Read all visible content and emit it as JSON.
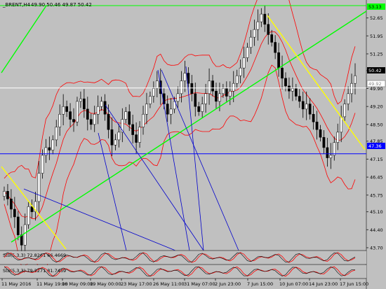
{
  "chart_data": {
    "type": "candlestick",
    "symbol_line": "_BRENT,H4",
    "ohlc_text": "49.90 50.46 49.87 50.42",
    "price_levels": {
      "top_line": 53.13,
      "current": 50.42,
      "ask_line": 49.92,
      "support_line": 47.36
    },
    "y_ticks": [
      "52.65",
      "51.95",
      "51.25",
      "50.60",
      "49.90",
      "49.20",
      "48.50",
      "47.85",
      "47.15",
      "46.45",
      "45.75",
      "45.10",
      "44.40",
      "43.70"
    ],
    "x_ticks": [
      "11 May 2016",
      "11 May 19:00",
      "16 May 09:00",
      "19 May 00:00",
      "23 May 17:00",
      "26 May 11:00",
      "31 May 07:00",
      "2 Jun 23:00",
      "7 Jun 15:00",
      "10 Jun 07:00",
      "14 Jun 23:00",
      "17 Jun 15:00"
    ],
    "price_close_series": [
      45.9,
      45.6,
      45.2,
      44.9,
      44.2,
      43.8,
      44.6,
      45.3,
      45.1,
      45.5,
      46.6,
      47.3,
      47.6,
      47.5,
      47.9,
      48.4,
      48.9,
      49.2,
      49.0,
      48.7,
      48.6,
      49.4,
      49.5,
      49.1,
      48.7,
      48.5,
      48.9,
      49.2,
      49.4,
      48.9,
      48.3,
      47.7,
      47.9,
      48.2,
      48.7,
      49.0,
      48.5,
      48.1,
      47.8,
      48.4,
      48.9,
      49.3,
      49.6,
      49.9,
      50.2,
      49.7,
      49.3,
      48.9,
      49.1,
      49.4,
      49.7,
      50.2,
      50.5,
      50.1,
      49.7,
      49.2,
      49.0,
      49.3,
      49.7,
      50.2,
      49.8,
      49.4,
      49.7,
      49.9,
      49.6,
      49.8,
      50.1,
      50.4,
      50.7,
      51.1,
      51.5,
      51.9,
      52.2,
      52.5,
      52.8,
      52.4,
      52.0,
      51.7,
      51.3,
      50.7,
      50.3,
      50.0,
      49.8,
      49.9,
      49.6,
      49.4,
      49.1,
      49.3,
      48.9,
      48.6,
      48.3,
      48.0,
      47.6,
      47.2,
      47.3,
      47.8,
      48.2,
      48.8,
      49.3,
      49.7,
      50.1,
      50.4
    ],
    "indicators": [
      {
        "label": "Sto(5,3,3) 72.8261 66.4669"
      },
      {
        "label": "Sto(5,3,3) 79.2271 81.7469"
      }
    ],
    "colors": {
      "background": "#c0c0c0",
      "bull_candle": "#ffffff",
      "bear_candle": "#000000",
      "bands": "#ff0000",
      "trend_green": "#00ff00",
      "trend_yellow": "#ffff00",
      "fan_blue": "#0000cc",
      "support_blue": "#0000ff"
    }
  }
}
